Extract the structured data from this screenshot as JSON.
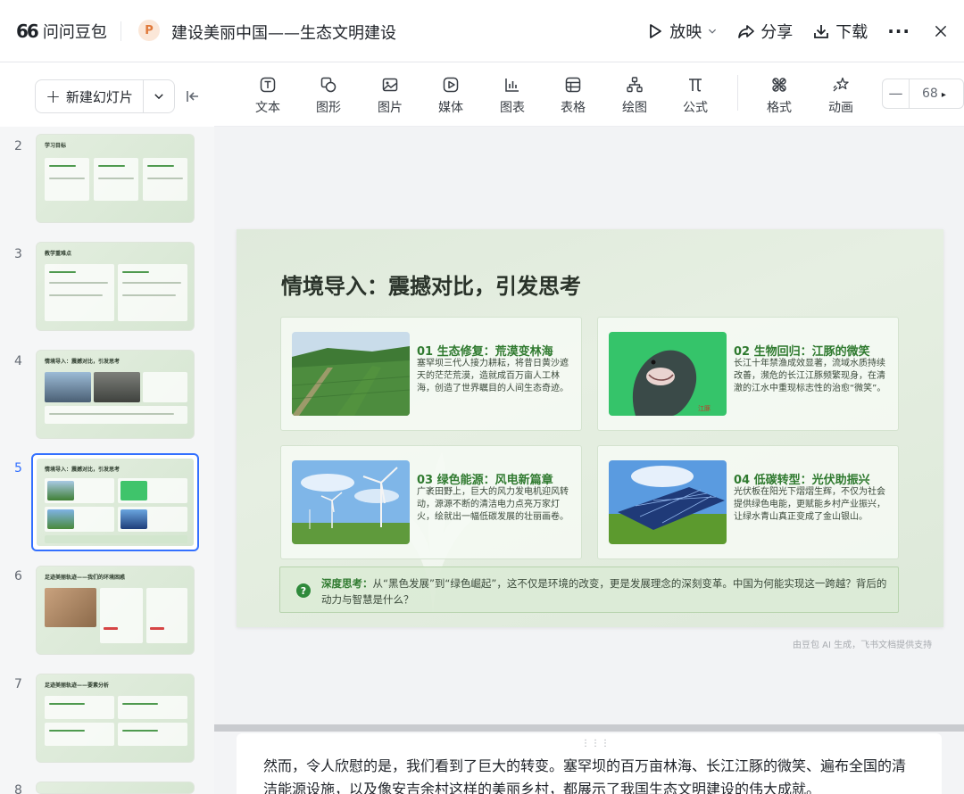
{
  "app": {
    "brand": "问问豆包",
    "brand_mark": "66",
    "doc_badge": "P",
    "doc_title": "建设美丽中国——生态文明建设"
  },
  "topbar": {
    "play": "放映",
    "share": "分享",
    "download": "下载",
    "more": "···",
    "close": "✕"
  },
  "sidebar": {
    "new_slide": "新建幻灯片",
    "slides": [
      {
        "num": "2",
        "title": "学习目标"
      },
      {
        "num": "3",
        "title": "教学重难点"
      },
      {
        "num": "4",
        "title": "情境导入：震撼对比，引发思考"
      },
      {
        "num": "5",
        "title": "情境导入：震撼对比，引发思考",
        "active": true
      },
      {
        "num": "6",
        "title": "足迹美丽轨迹——我们的环境困惑"
      },
      {
        "num": "7",
        "title": "足迹美丽轨迹——要素分析"
      },
      {
        "num": "8",
        "title": ""
      }
    ]
  },
  "toolbar": {
    "items": [
      {
        "label": "文本",
        "icon": "text-icon"
      },
      {
        "label": "图形",
        "icon": "shape-icon"
      },
      {
        "label": "图片",
        "icon": "image-icon"
      },
      {
        "label": "媒体",
        "icon": "media-icon"
      },
      {
        "label": "图表",
        "icon": "chart-icon"
      },
      {
        "label": "表格",
        "icon": "table-icon"
      },
      {
        "label": "绘图",
        "icon": "diagram-icon"
      },
      {
        "label": "公式",
        "icon": "formula-icon"
      },
      {
        "label": "格式",
        "icon": "format-icon"
      },
      {
        "label": "动画",
        "icon": "animation-icon"
      }
    ],
    "zoom_minus": "—",
    "zoom_value": "68"
  },
  "slide": {
    "title": "情境导入：震撼对比，引发思考",
    "cards": [
      {
        "title": "01 生态修复：荒漠变林海",
        "body": "塞罕坝三代人接力耕耘，将昔日黄沙遮天的茫茫荒漠，造就成百万亩人工林海，创造了世界瞩目的人间生态奇迹。"
      },
      {
        "title": "02 生物回归：江豚的微笑",
        "body": "长江十年禁渔成效显著，流域水质持续改善，濒危的长江江豚频繁现身，在清澈的江水中重现标志性的治愈“微笑”。"
      },
      {
        "title": "03 绿色能源：风电新篇章",
        "body": "广袤田野上，巨大的风力发电机迎风转动，源源不断的清洁电力点亮万家灯火，绘就出一幅低碳发展的壮丽画卷。"
      },
      {
        "title": "04 低碳转型：光伏助振兴",
        "body": "光伏板在阳光下熠熠生辉，不仅为社会提供绿色电能，更赋能乡村产业振兴，让绿水青山真正变成了金山银山。"
      }
    ],
    "think_label": "深度思考：",
    "think_text": "从“黑色发展”到“绿色崛起”，这不仅是环境的改变，更是发展理念的深刻变革。中国为何能实现这一跨越？背后的动力与智慧是什么？",
    "credit": "由豆包 AI 生成，飞书文档提供支持"
  },
  "notes": {
    "text": "然而，令人欣慰的是，我们看到了巨大的转变。塞罕坝的百万亩林海、长江江豚的微笑、遍布全国的清洁能源设施，以及像安吉余村这样的美丽乡村，都展示了我国生态文明建设的伟大成就。"
  }
}
